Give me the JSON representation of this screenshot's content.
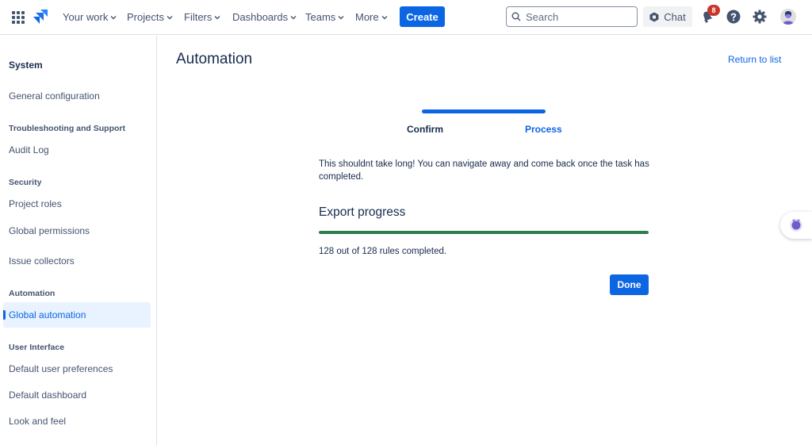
{
  "topnav": {
    "items": [
      {
        "label": "Your work"
      },
      {
        "label": "Projects"
      },
      {
        "label": "Filters"
      },
      {
        "label": "Dashboards"
      },
      {
        "label": "Teams"
      },
      {
        "label": "More"
      }
    ],
    "create_label": "Create",
    "search_placeholder": "Search",
    "chat_label": "Chat",
    "notification_count": "8",
    "accent": "#0c66e4"
  },
  "sidebar": {
    "title": "System",
    "items": [
      {
        "label": "General configuration"
      },
      {
        "heading": "Troubleshooting and Support"
      },
      {
        "label": "Audit Log"
      },
      {
        "heading": "Security"
      },
      {
        "label": "Project roles"
      },
      {
        "label": "Global permissions"
      },
      {
        "label": "Issue collectors"
      },
      {
        "heading": "Automation"
      },
      {
        "label": "Global automation",
        "active": true
      },
      {
        "heading": "User Interface"
      },
      {
        "label": "Default user preferences"
      },
      {
        "label": "Default dashboard"
      },
      {
        "label": "Look and feel"
      }
    ]
  },
  "main": {
    "title": "Automation",
    "return_link": "Return to list",
    "steps": {
      "confirm": "Confirm",
      "process": "Process"
    },
    "description": "This shouldnt take long! You can navigate away and come back once the task has completed.",
    "export_title": "Export progress",
    "progress_fraction": 1.0,
    "progress_color": "#2e7d4f",
    "progress_text": "128 out of 128 rules completed.",
    "done_label": "Done"
  }
}
